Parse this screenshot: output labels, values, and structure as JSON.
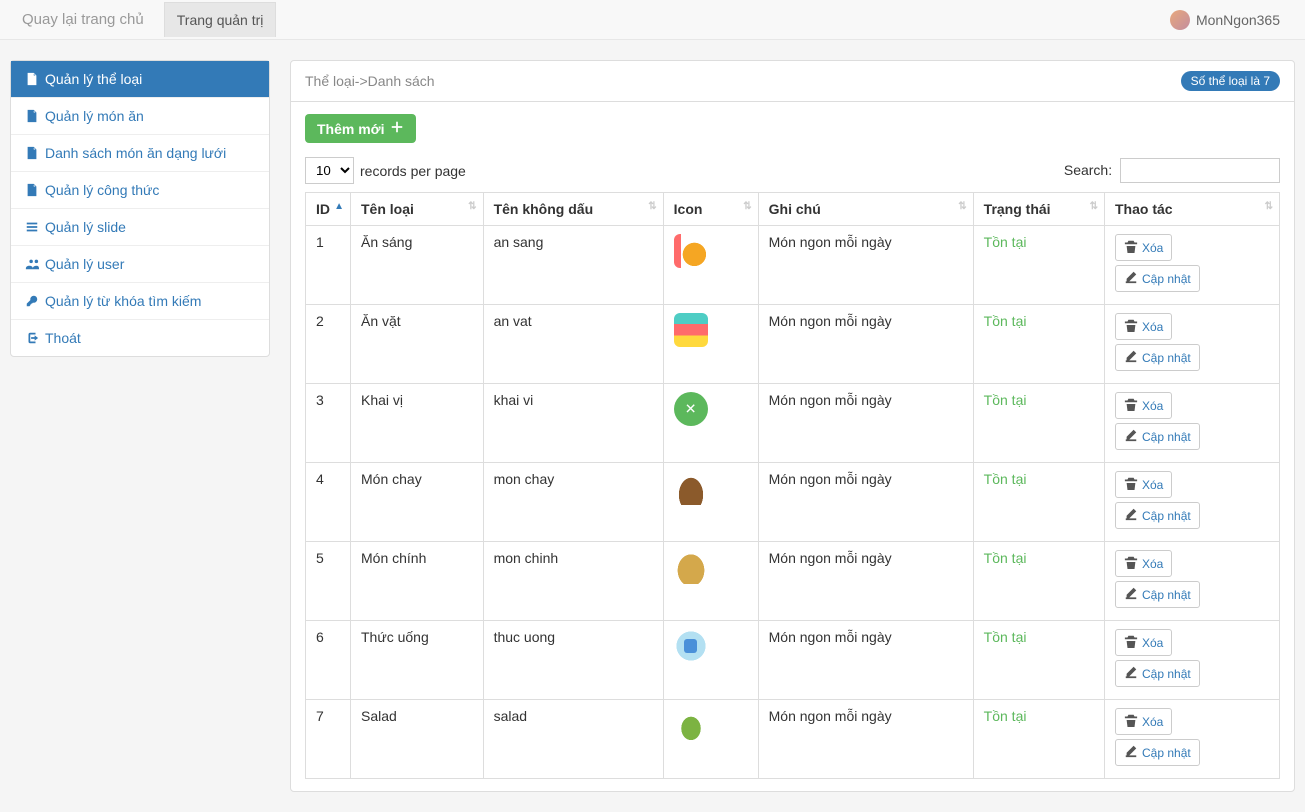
{
  "nav": {
    "home_link": "Quay lại trang chủ",
    "admin_tab": "Trang quản trị",
    "username": "MonNgon365"
  },
  "sidebar": {
    "items": [
      {
        "label": "Quản lý thể loại",
        "icon": "file"
      },
      {
        "label": "Quản lý món ăn",
        "icon": "file"
      },
      {
        "label": "Danh sách món ăn dạng lưới",
        "icon": "file"
      },
      {
        "label": "Quản lý công thức",
        "icon": "file"
      },
      {
        "label": "Quản lý slide",
        "icon": "list"
      },
      {
        "label": "Quản lý user",
        "icon": "users"
      },
      {
        "label": "Quản lý từ khóa tìm kiếm",
        "icon": "key"
      },
      {
        "label": "Thoát",
        "icon": "logout"
      }
    ]
  },
  "panel": {
    "breadcrumb": "Thể loại->Danh sách",
    "badge": "Số thể loại là 7",
    "add_button": "Thêm mới",
    "page_size": "10",
    "records_label": "records per page",
    "search_label": "Search:"
  },
  "table": {
    "headers": {
      "id": "ID",
      "name": "Tên loại",
      "slug": "Tên không dấu",
      "icon": "Icon",
      "note": "Ghi chú",
      "status": "Trạng thái",
      "action": "Thao tác"
    },
    "delete_label": "Xóa",
    "update_label": "Cập nhật",
    "rows": [
      {
        "id": "1",
        "name": "Ăn sáng",
        "slug": "an sang",
        "note": "Món ngon mỗi ngày",
        "status": "Tồn tại"
      },
      {
        "id": "2",
        "name": "Ăn vặt",
        "slug": "an vat",
        "note": "Món ngon mỗi ngày",
        "status": "Tồn tại"
      },
      {
        "id": "3",
        "name": "Khai vị",
        "slug": "khai vi",
        "note": "Món ngon mỗi ngày",
        "status": "Tồn tại"
      },
      {
        "id": "4",
        "name": "Món chay",
        "slug": "mon chay",
        "note": "Món ngon mỗi ngày",
        "status": "Tồn tại"
      },
      {
        "id": "5",
        "name": "Món chính",
        "slug": "mon chinh",
        "note": "Món ngon mỗi ngày",
        "status": "Tồn tại"
      },
      {
        "id": "6",
        "name": "Thức uống",
        "slug": "thuc uong",
        "note": "Món ngon mỗi ngày",
        "status": "Tồn tại"
      },
      {
        "id": "7",
        "name": "Salad",
        "slug": "salad",
        "note": "Món ngon mỗi ngày",
        "status": "Tồn tại"
      }
    ]
  }
}
